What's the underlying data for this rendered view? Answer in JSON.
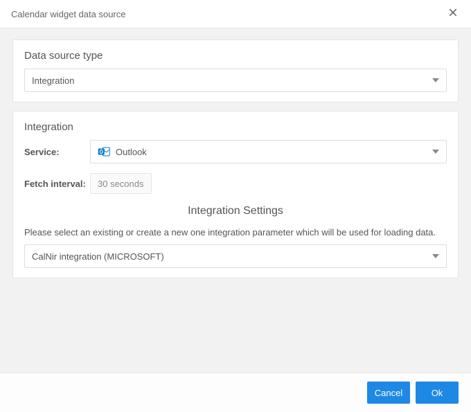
{
  "header": {
    "title": "Calendar widget data source"
  },
  "data_source_type_panel": {
    "heading": "Data source type",
    "selected": "Integration"
  },
  "integration_panel": {
    "heading": "Integration",
    "service_label": "Service:",
    "service_selected": "Outlook",
    "fetch_interval_label": "Fetch interval:",
    "fetch_interval_value": "30 seconds",
    "settings_heading": "Integration Settings",
    "help_text": "Please select an existing or create a new one integration parameter which will be used for loading data.",
    "integration_selected": "CalNir integration (MICROSOFT)"
  },
  "footer": {
    "cancel": "Cancel",
    "ok": "Ok"
  }
}
